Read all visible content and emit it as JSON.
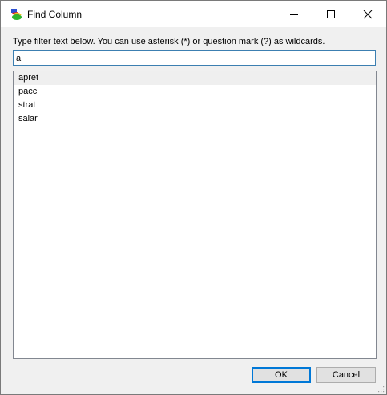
{
  "window": {
    "title": "Find Column",
    "icon": "app-icon",
    "controls": [
      "minimize-icon",
      "maximize-icon",
      "close-icon"
    ]
  },
  "instruction": "Type filter text below. You can use asterisk (*) or question mark (?) as wildcards.",
  "filter": {
    "value": "a"
  },
  "list": {
    "items": [
      {
        "label": "apret"
      },
      {
        "label": "pacc"
      },
      {
        "label": "strat"
      },
      {
        "label": "salar"
      }
    ],
    "selected_index": 0
  },
  "buttons": {
    "ok_label": "OK",
    "cancel_label": "Cancel"
  },
  "colors": {
    "focus_border": "#0078d7",
    "window_bg": "#f0f0f0",
    "selected_row": "#efefef"
  }
}
